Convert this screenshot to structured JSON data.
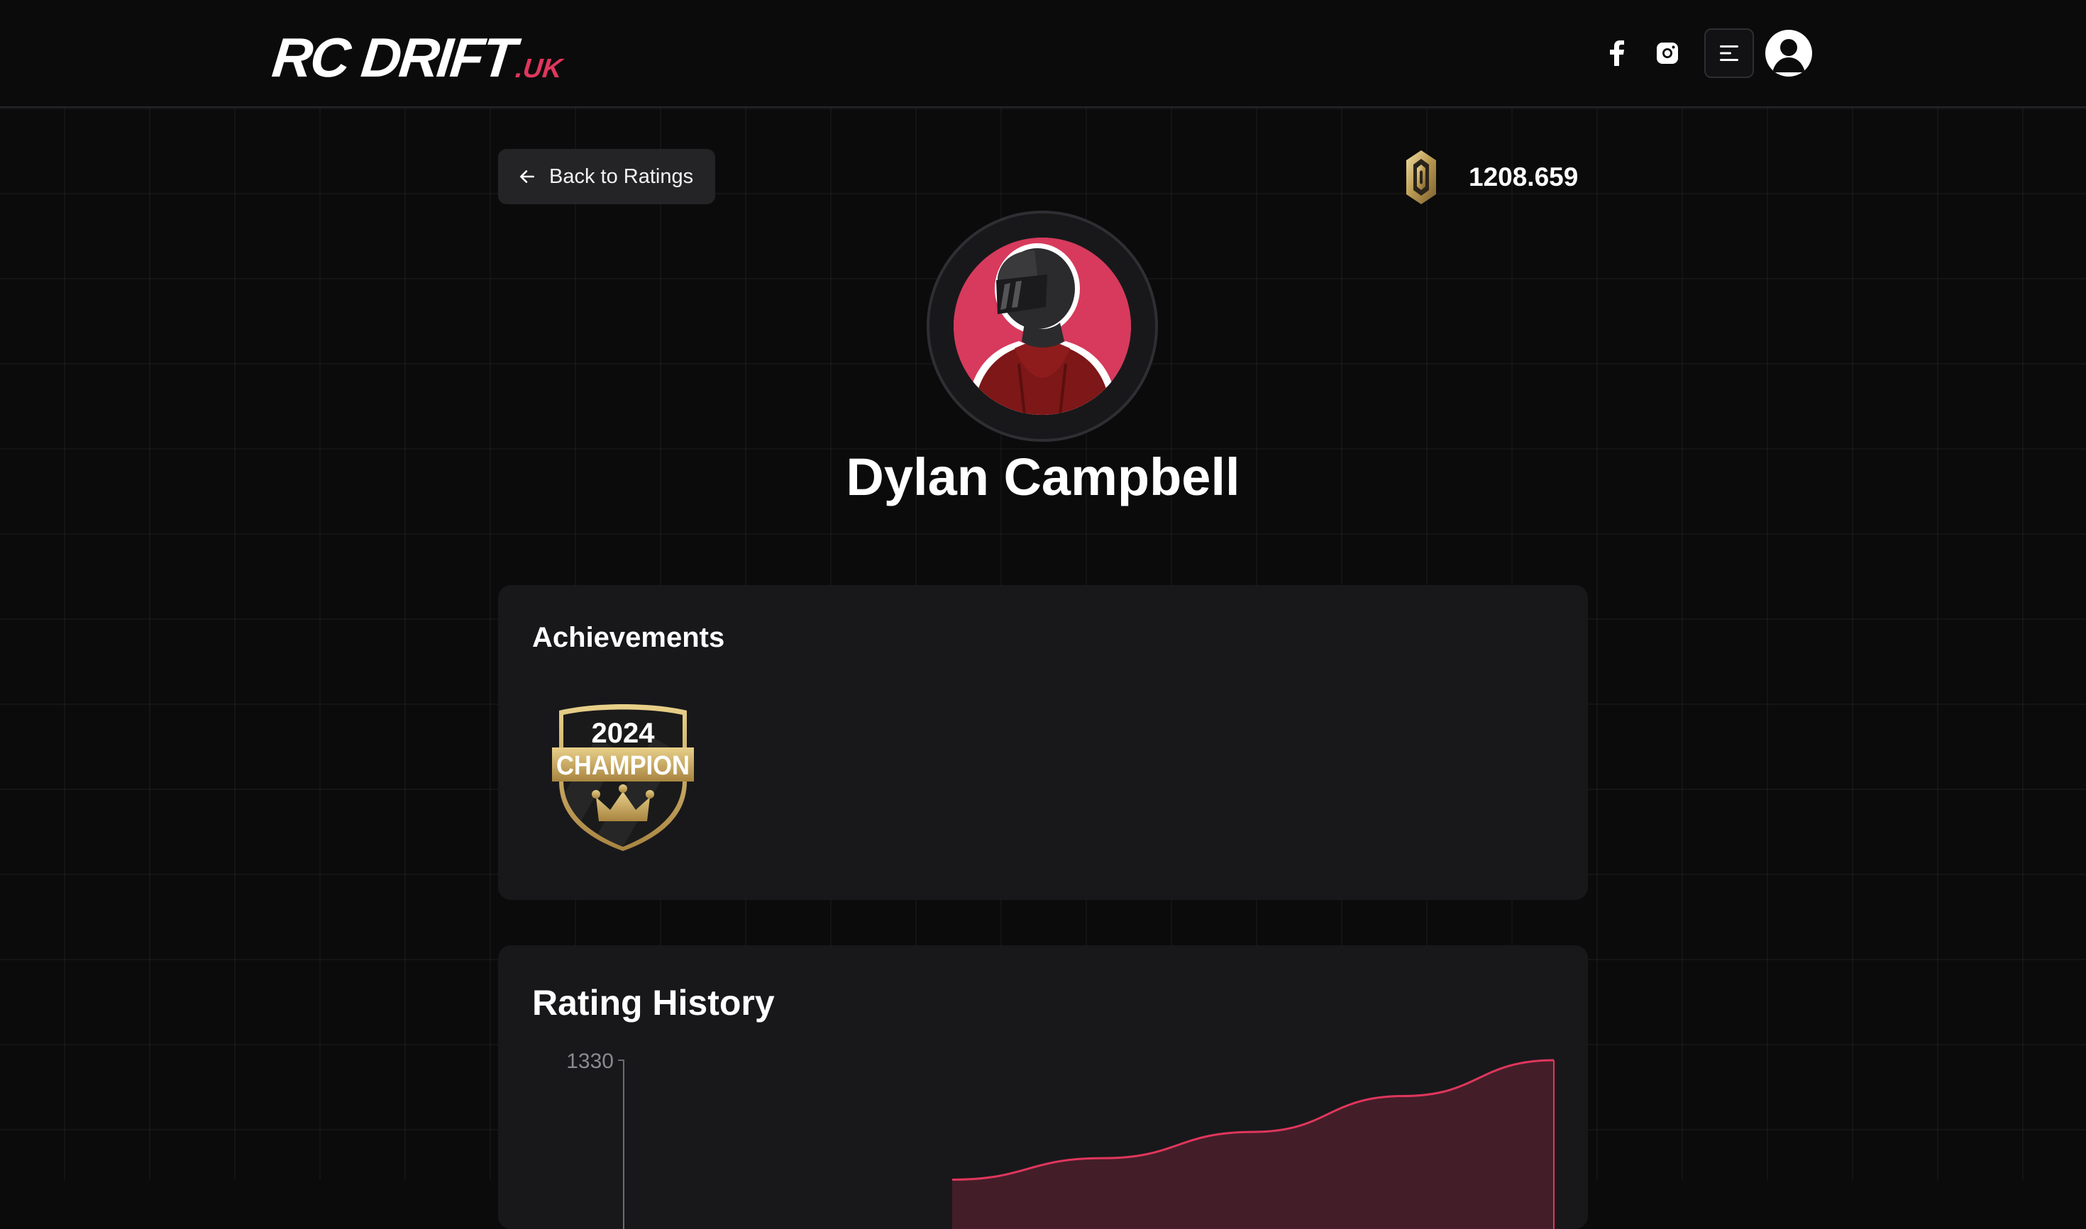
{
  "header": {
    "logo_main": "RC DRIFT",
    "logo_suffix": ".UK",
    "icons": [
      "facebook-icon",
      "instagram-icon",
      "menu-icon",
      "user-icon"
    ]
  },
  "profile": {
    "back_label": "Back to Ratings",
    "rating": "1208.659",
    "name": "Dylan Campbell"
  },
  "achievements": {
    "title": "Achievements",
    "badges": [
      {
        "year": "2024",
        "label": "CHAMPION"
      }
    ]
  },
  "rating_history": {
    "title": "Rating History"
  },
  "colors": {
    "accent": "#e0365c",
    "background": "#0b0b0c",
    "card": "#18181b",
    "gold": "#c9a75e"
  },
  "chart_data": {
    "type": "area",
    "title": "Rating History",
    "y_tick_labels": [
      "1330"
    ],
    "series": [
      {
        "values": [
          1280,
          1289,
          1300,
          1315,
          1330
        ]
      }
    ],
    "color": "#e0365c"
  }
}
